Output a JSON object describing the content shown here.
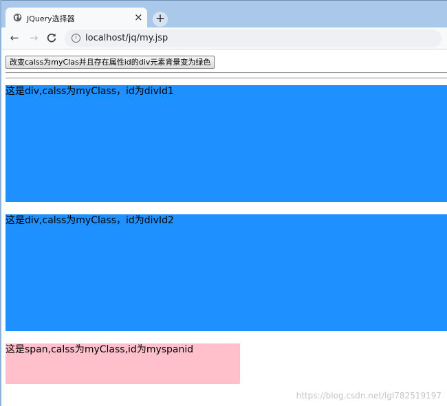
{
  "browser": {
    "tab_title": "JQuery选择器",
    "tab_close": "×",
    "new_tab": "+",
    "url": "localhost/jq/my.jsp",
    "back": "←",
    "forward": "→",
    "reload": "C",
    "info": "i"
  },
  "page": {
    "button_label": "改变calss为myClas并且存在属性id的div元素背景变为绿色",
    "div1_text": "这是div,calss为myClass，id为divId1",
    "div2_text": "这是div,calss为myClass，id为divId2",
    "span_text": "这是span,calss为myClass,id为myspanid",
    "colors": {
      "div_bg": "#1e90ff",
      "span_bg": "#ffc0cb"
    }
  },
  "watermark": "https://blog.csdn.net/lgl782519197"
}
